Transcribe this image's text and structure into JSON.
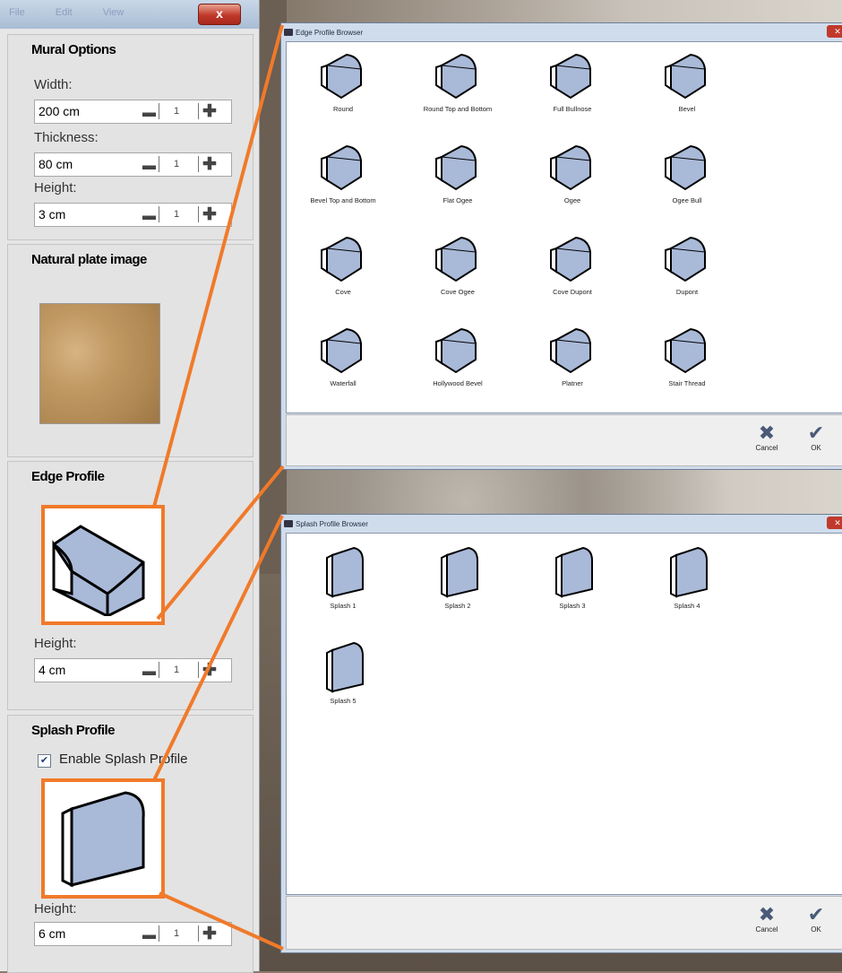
{
  "titlebar": {
    "tabs": [
      "File",
      "Edit",
      "View"
    ],
    "close_label": "x"
  },
  "mural_options": {
    "title": "Mural Options",
    "width_label": "Width:",
    "width_value": "200 cm",
    "thickness_label": "Thickness:",
    "thickness_value": "80 cm",
    "height_label": "Height:",
    "height_value": "3 cm",
    "step": "1"
  },
  "natural_plate": {
    "title": "Natural plate image"
  },
  "edge_profile": {
    "title": "Edge Profile",
    "height_label": "Height:",
    "height_value": "4 cm",
    "step": "1"
  },
  "splash_profile": {
    "title": "Splash Profile",
    "enable_label": "Enable Splash Profile",
    "enable_checked": true,
    "height_label": "Height:",
    "height_value": "6 cm",
    "step": "1"
  },
  "edge_browser": {
    "title": "Edge Profile Browser",
    "items": [
      "Round",
      "Round Top and Bottom",
      "Full Bullnose",
      "Bevel",
      "Bevel Top and Bottom",
      "Flat Ogee",
      "Ogee",
      "Ogee Bull",
      "Cove",
      "Cove Ogee",
      "Cove Dupont",
      "Dupont",
      "Waterfall",
      "Hollywood Bevel",
      "Platner",
      "Stair Thread"
    ],
    "cancel_label": "Cancel",
    "ok_label": "OK"
  },
  "splash_browser": {
    "title": "Splash Profile Browser",
    "items": [
      "Splash 1",
      "Splash 2",
      "Splash 3",
      "Splash 4",
      "Splash 5"
    ],
    "cancel_label": "Cancel",
    "ok_label": "OK"
  },
  "colors": {
    "profile_fill": "#a9b9d8",
    "callout": "#f07a2a",
    "close_red": "#c0392b"
  }
}
